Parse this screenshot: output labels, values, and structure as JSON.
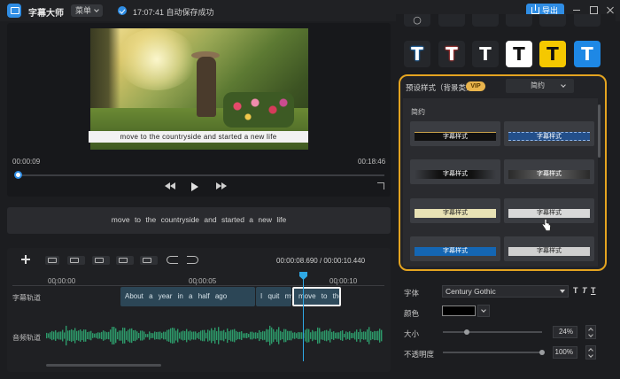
{
  "app": {
    "title": "字幕大师",
    "menu_label": "菜单",
    "save_status": "17:07:41 自动保存成功",
    "export_label": "导出"
  },
  "preview": {
    "subtitle": "move to the countryside and started a new life",
    "current_time": "00:00:09",
    "total_time": "00:18:46"
  },
  "subtitle_editor": {
    "text": "move to the countryside and started a new life"
  },
  "timeline": {
    "current": "00:00:08.690",
    "separator": "/",
    "total": "00:00:10.440",
    "ruler": [
      "00:00:00",
      "00:00:05",
      "00:00:10"
    ],
    "tracks": {
      "subtitle": "字幕轨道",
      "audio": "音频轨道"
    },
    "clips": [
      "About a year in a half ago",
      "I quit my",
      "move to the"
    ]
  },
  "style_panel": {
    "preset_label": "预设样式（背景类）",
    "vip": "VIP",
    "selected_style": "简约",
    "group_label": "简约",
    "card_label": "字幕样式",
    "tile_glyph": "T"
  },
  "properties": {
    "font_label": "字体",
    "font_value": "Century Gothic",
    "bold": "T",
    "italic": "T",
    "underline": "T",
    "color_label": "颜色",
    "color_value": "#000000",
    "size_label": "大小",
    "size_value": "24%",
    "size_fraction": 0.24,
    "opacity_label": "不透明度",
    "opacity_value": "100%",
    "opacity_fraction": 1.0
  },
  "colors": {
    "accent": "#2f8de4",
    "highlight": "#e4a420",
    "vip": "#e9b44c",
    "tile_red": "#e53935",
    "tile_yellow": "#f5c800",
    "tile_blue": "#1e88e5"
  }
}
